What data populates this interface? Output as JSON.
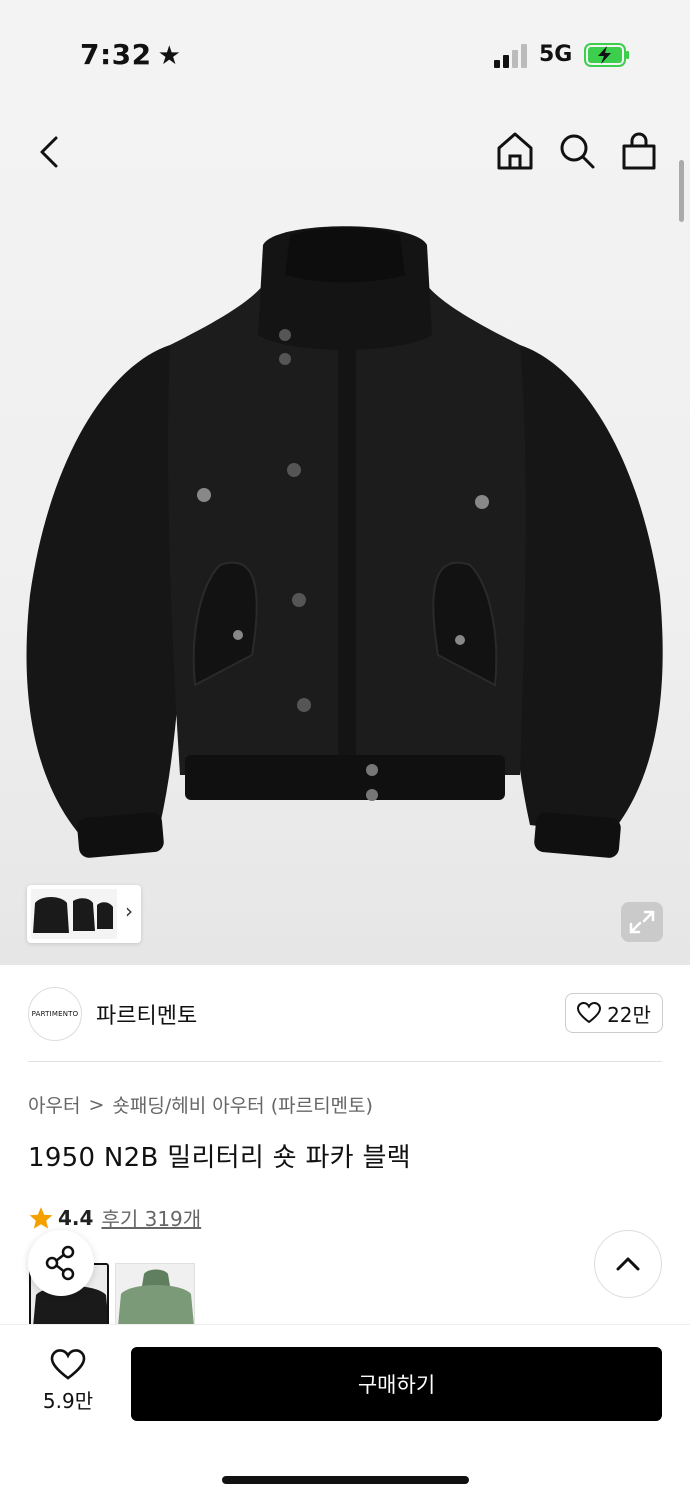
{
  "status_bar": {
    "time": "7:32",
    "network": "5G",
    "star_icon": "star-icon",
    "battery_color": "#3ccf4e"
  },
  "navigation": {
    "back_icon": "chevron-left-icon",
    "home_icon": "home-icon",
    "search_icon": "search-icon",
    "cart_icon": "shopping-bag-icon"
  },
  "product_images": {
    "main_image": "black bomber parka jacket",
    "thumbnail_more_icon": "chevron-right-icon",
    "zoom_icon": "expand-icon"
  },
  "brand": {
    "logo_text": "PARTIMENTO",
    "name": "파르티멘토",
    "like_count": "22만"
  },
  "breadcrumb": {
    "category": "아우터",
    "separator": ">",
    "subcategory": "숏패딩/헤비 아우터 (파르티멘토)"
  },
  "product": {
    "title": "1950 N2B 밀리터리 숏 파카 블랙",
    "rating": "4.4",
    "reviews": "후기 319개",
    "rating_color": "#f4a100"
  },
  "swatches": [
    {
      "name": "black",
      "color": "#1a1a1a"
    },
    {
      "name": "green",
      "color": "#7a9a78"
    }
  ],
  "floating": {
    "share_icon": "share-icon",
    "scroll_top_icon": "chevron-up-icon"
  },
  "bottom_bar": {
    "favorite_count": "5.9만",
    "buy_label": "구매하기"
  }
}
